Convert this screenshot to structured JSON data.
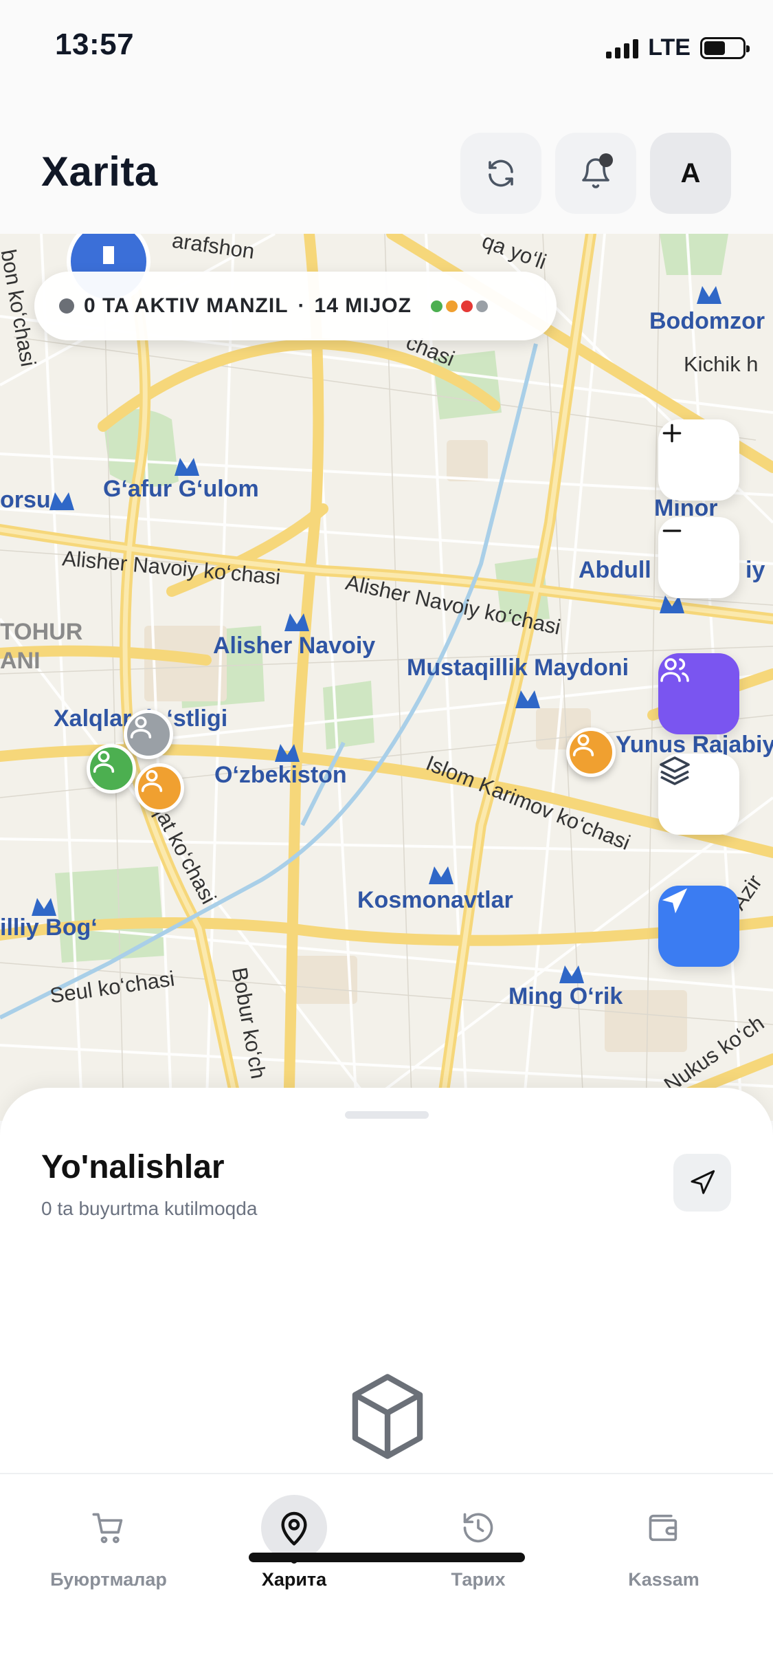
{
  "status_bar": {
    "time": "13:57",
    "network": "LTE",
    "battery_level": 0.55
  },
  "header": {
    "title": "Xarita",
    "refresh_icon": "refresh-icon",
    "bell_icon": "bell-icon",
    "avatar_letter": "A"
  },
  "map": {
    "info_pill": {
      "active_text": "0 TA AKTIV MANZIL",
      "separator": "·",
      "clients_text": "14 MIJOZ",
      "dot_colors": [
        "#4caf50",
        "#f0a030",
        "#e53935",
        "#9aa0a6"
      ]
    },
    "labels": {
      "bodomzor": "Bodomzor",
      "kichik": "Kichik h",
      "gafur_gulom": "G‘afur G‘ulom",
      "minor": "Minor",
      "orsu": "orsu",
      "abdull": "Abdull",
      "iy": "iy",
      "alisher_navoiy_street_1": "Alisher Navoiy ko‘chasi",
      "alisher_navoiy_street_2": "Alisher Navoiy ko‘chasi",
      "tohur": "TOHUR",
      "ani": "ANI",
      "alisher_navoiy": "Alisher Navoiy",
      "mustaqillik": "Mustaqillik Maydoni",
      "xalqlar": "Xalqlar do‘stligi",
      "yunus": "Yunus Rajabiy",
      "ozbekiston": "O‘zbekiston",
      "islom_karimov": "Islom Karimov ko‘chasi",
      "urqat": "urqat ko‘chasi",
      "kosmonavtlar": "Kosmonavtlar",
      "azir": "Azir",
      "milliy_bog": "illiy Bog‘",
      "seul": "Seul ko‘chasi",
      "bobur": "Bobur ko‘ch",
      "ming_orik": "Ming O‘rik",
      "nukus": "Nukus ko‘ch",
      "zarafshon": "arafshon",
      "bon": "bon ko‘chasi",
      "chasi": "chasi",
      "qa_yoli": "qa yo‘li"
    },
    "controls": {
      "zoom_in": "+",
      "zoom_out": "−",
      "clients_icon": "users-icon",
      "layers_icon": "layers-icon",
      "locate_icon": "navigation-arrow-icon"
    },
    "colors": {
      "people_button": "#7a55f0",
      "locate_button": "#3b7cf2",
      "marker_orange": "#f0a030",
      "marker_green": "#4caf50",
      "marker_grey": "#9aa0a6"
    }
  },
  "sheet": {
    "title": "Yo'nalishlar",
    "subtitle": "0 ta buyurtma kutilmoqda",
    "action_icon": "navigation-icon",
    "empty_icon": "package-icon"
  },
  "nav": {
    "items": [
      {
        "label": "Буюртмалар",
        "icon": "cart-icon",
        "active": false
      },
      {
        "label": "Харита",
        "icon": "map-pin-icon",
        "active": true
      },
      {
        "label": "Тарих",
        "icon": "history-icon",
        "active": false
      },
      {
        "label": "Kassam",
        "icon": "wallet-icon",
        "active": false
      }
    ]
  }
}
